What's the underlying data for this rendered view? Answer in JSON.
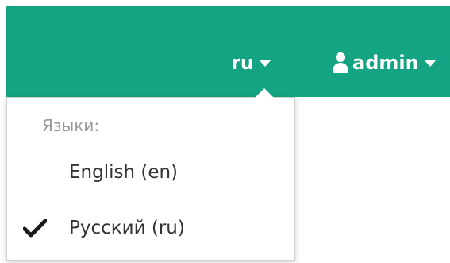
{
  "navbar": {
    "lang_toggle_label": "ru",
    "user_toggle_label": "admin"
  },
  "language_menu": {
    "header": "Языки:",
    "items": [
      {
        "label": "English (en)",
        "selected": false
      },
      {
        "label": "Русский (ru)",
        "selected": true
      }
    ]
  },
  "colors": {
    "navbar_bg": "#14a383",
    "menu_text": "#333333",
    "menu_header_text": "#9a9a9a"
  },
  "icons": [
    "caret-down-icon",
    "user-icon",
    "checkmark-icon"
  ]
}
